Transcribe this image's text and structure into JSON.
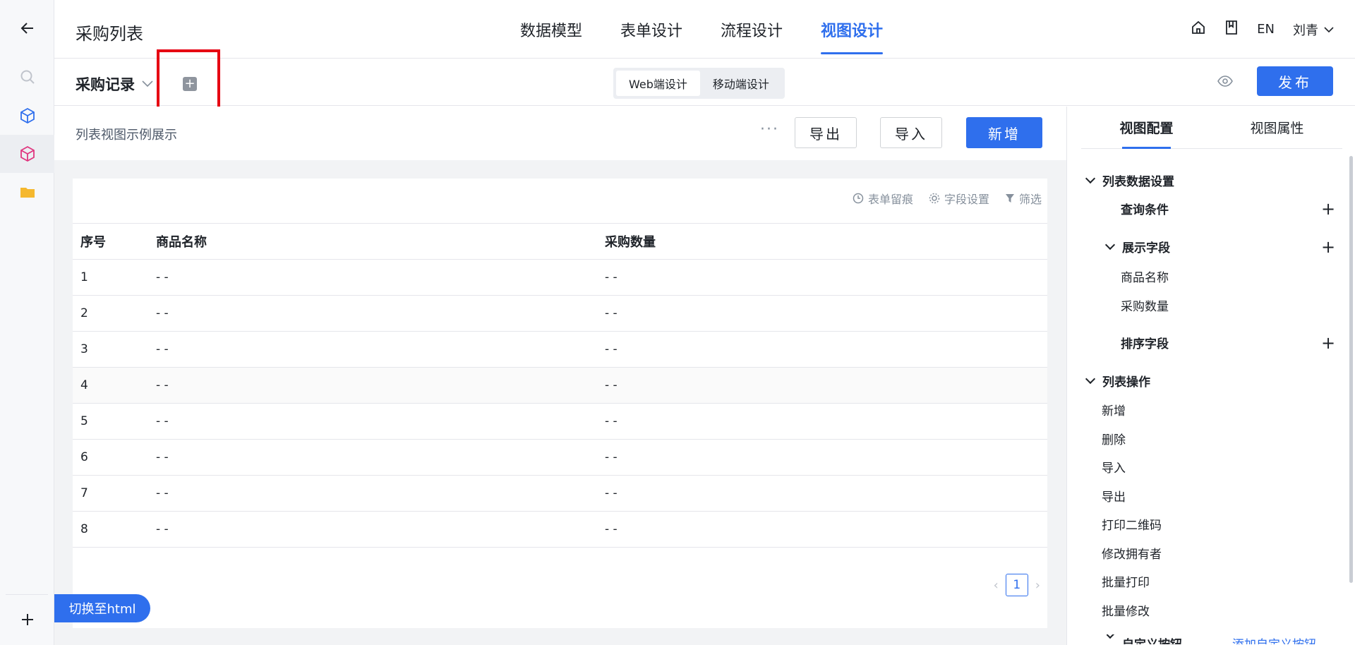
{
  "header": {
    "app_title": "采购列表",
    "nav_tabs": [
      "数据模型",
      "表单设计",
      "流程设计",
      "视图设计"
    ],
    "active_tab": "视图设计",
    "lang": "EN",
    "user": "刘青"
  },
  "subheader": {
    "view_name": "采购记录",
    "segments": [
      "Web端设计",
      "移动端设计"
    ],
    "publish_label": "发布"
  },
  "canvas": {
    "title": "列表视图示例展示",
    "more": "···",
    "buttons": {
      "export": "导出",
      "import": "导入",
      "add": "新增"
    },
    "tools": {
      "history": "表单留痕",
      "fields": "字段设置",
      "filter": "筛选"
    },
    "columns": [
      "序号",
      "商品名称",
      "采购数量"
    ],
    "rows": [
      [
        "1",
        "- -",
        "- -"
      ],
      [
        "2",
        "- -",
        "- -"
      ],
      [
        "3",
        "- -",
        "- -"
      ],
      [
        "4",
        "- -",
        "- -"
      ],
      [
        "5",
        "- -",
        "- -"
      ],
      [
        "6",
        "- -",
        "- -"
      ],
      [
        "7",
        "- -",
        "- -"
      ],
      [
        "8",
        "- -",
        "- -"
      ]
    ],
    "page": "1",
    "switch_html": "切换至html"
  },
  "panel": {
    "tabs": [
      "视图配置",
      "视图属性"
    ],
    "section_list_data": "列表数据设置",
    "query_conditions": "查询条件",
    "display_fields": "展示字段",
    "display_items": [
      "商品名称",
      "采购数量"
    ],
    "sort_fields": "排序字段",
    "section_list_ops": "列表操作",
    "ops": [
      "新增",
      "删除",
      "导入",
      "导出",
      "打印二维码",
      "修改拥有者",
      "批量打印",
      "批量修改"
    ],
    "custom_buttons": "自定义按钮",
    "add_custom_button": "添加自定义按钮"
  },
  "colors": {
    "accent": "#2f6fed",
    "highlight": "#e60012"
  }
}
